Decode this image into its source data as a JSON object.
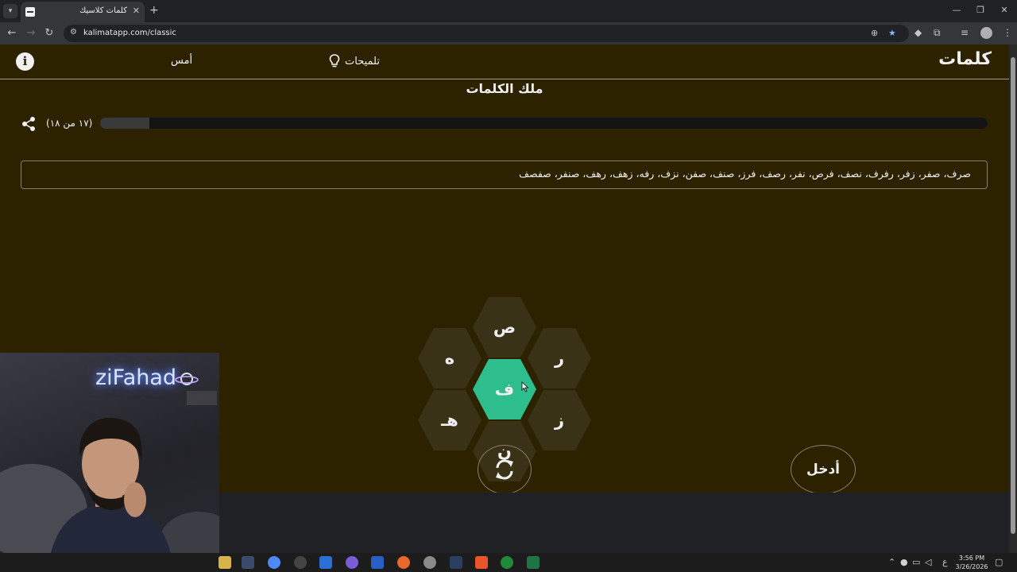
{
  "browser": {
    "tab_title": "كلمات كلاسيك",
    "tab_close": "✕",
    "new_tab": "+",
    "url": "kalimatapp.com/classic"
  },
  "header": {
    "logo": "كلمات",
    "hints_label": "تلميحات",
    "yesterday_label": "أمس",
    "info_label": "i"
  },
  "rank_title": "ملك الكلمات",
  "progress": {
    "label": "(١٧ من ١٨)",
    "found": 17,
    "total": 18
  },
  "found_words": "صرف، صفر، زفر، رفرف، نصف، فرص، نفر، رصف، فرز، صنف، صفن، نزف، رفه، زهف، رهف، صنفر، صفصف",
  "letters": {
    "center": "ف",
    "top": "ص",
    "top_right": "ر",
    "bottom_right": "ز",
    "bottom": "ن",
    "bottom_left": "هـ",
    "top_left": "ه"
  },
  "actions": {
    "enter_label": "أدخل",
    "shuffle_icon": "refresh-icon"
  },
  "webcam": {
    "neon_text": "ziFahad"
  },
  "taskbar": {
    "time": "3:56 PM",
    "date": "3/26/2026",
    "lang": "ع"
  },
  "colors": {
    "page_bg": "#2c2200",
    "hex_bg": "#3a3217",
    "center_hex": "#2ebd8c"
  }
}
